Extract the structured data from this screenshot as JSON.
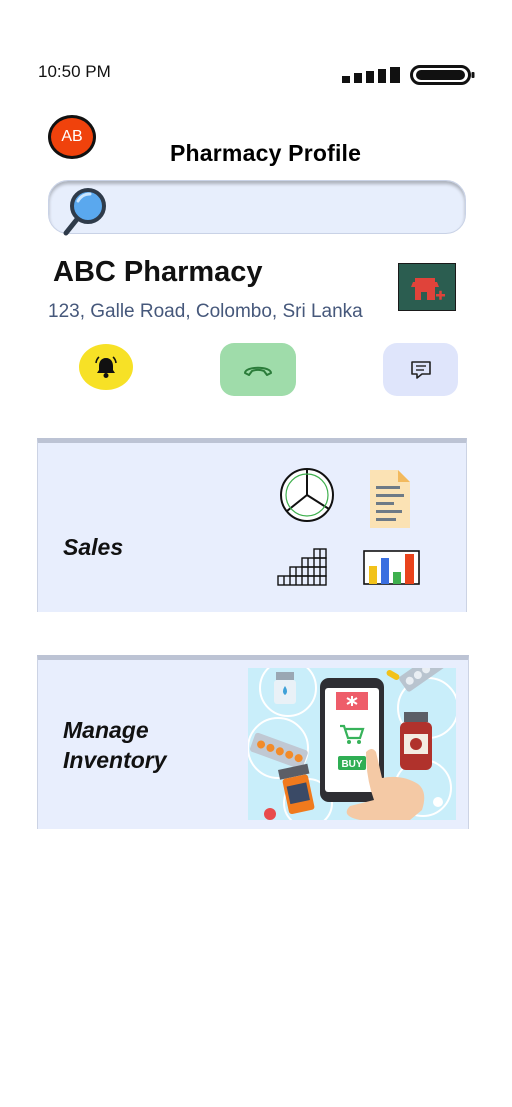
{
  "status_bar": {
    "time": "10:50 PM"
  },
  "header": {
    "avatar_initials": "AB",
    "title": "Pharmacy Profile"
  },
  "search": {
    "placeholder": ""
  },
  "pharmacy": {
    "name": "ABC Pharmacy",
    "address": "123, Galle Road, Colombo, Sri Lanka"
  },
  "actions": [
    {
      "icon": "bell-icon",
      "color": "#f7e126"
    },
    {
      "icon": "phone-icon",
      "color": "#9fdcaa"
    },
    {
      "icon": "message-icon",
      "color": "#dfe5fb"
    }
  ],
  "cards": {
    "sales": {
      "label": "Sales"
    },
    "inventory": {
      "label_line1": "Manage",
      "label_line2": "Inventory",
      "image_text": "BUY"
    }
  },
  "colors": {
    "avatar": "#f0420c",
    "store_badge": "#2b5d50",
    "card_bg": "#e8eefd",
    "address_text": "#46587b"
  }
}
